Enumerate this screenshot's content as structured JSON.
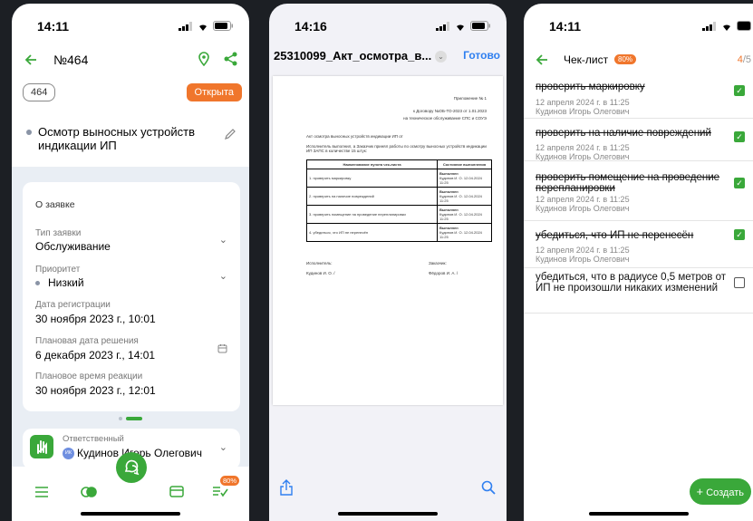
{
  "phone1": {
    "time": "14:11",
    "title": "№464",
    "number_badge": "464",
    "status_badge": "Открыта",
    "subject": "Осмотр выносных устройств индикации ИП",
    "card_title": "О заявке",
    "fields": [
      {
        "label": "Тип заявки",
        "value": "Обслуживание"
      },
      {
        "label": "Приоритет",
        "value": "Низкий"
      },
      {
        "label": "Дата регистрации",
        "value": "30 ноября 2023 г., 10:01"
      },
      {
        "label": "Плановая дата решения",
        "value": "6 декабря 2023 г., 14:01"
      },
      {
        "label": "Плановое время реакции",
        "value": "30 ноября 2023 г., 12:01"
      }
    ],
    "responsible_label": "Ответственный",
    "responsible_initials": "ИК",
    "responsible_name": "Кудинов Игорь Олегович",
    "tab_badge": "80%",
    "colors": {
      "accent": "#3aa83a",
      "orange": "#f0762c"
    }
  },
  "phone2": {
    "time": "14:16",
    "file_title": "25310099_Акт_осмотра_в...",
    "done_label": "Готово",
    "doc": {
      "appendix": "Приложение № 1",
      "contract_line1": "к Договору №ОБ-ТО-2023 от 1.01.2023",
      "contract_line2": "на техническое обслуживание СПС и СОУЭ",
      "act_title": "Акт осмотра выносных устройств индикации ИП от",
      "intro": "Исполнитель выполнил, а Заказчик принял работы по осмотру выносных устройств индикации ИП ЗАПС в количестве 15 штук:",
      "col1": "Наименование пункта чек-листа",
      "col2": "Состояние выполнения",
      "rows": [
        {
          "name": "1. проверить маркировку",
          "status": "Выполнен",
          "who": "Кудинов И. О. 12.04.2024 11:25"
        },
        {
          "name": "2. проверить на наличие повреждений",
          "status": "Выполнен",
          "who": "Кудинов И. О. 12.04.2024 11:25"
        },
        {
          "name": "3. проверить помещение на проведение перепланировки",
          "status": "Выполнен",
          "who": "Кудинов И. О. 12.04.2024 11:25"
        },
        {
          "name": "4. убедиться, что ИП не перенесён",
          "status": "Выполнен",
          "who": "Кудинов И. О. 12.04.2024 11:25"
        }
      ],
      "executor_label": "Исполнитель:",
      "customer_label": "Заказчик:",
      "executor_name": "Кудинов И. О. /",
      "customer_name": "Фёдоров И. А. /"
    }
  },
  "phone3": {
    "time": "14:11",
    "title": "Чек-лист",
    "progress_badge": "80%",
    "counter_done": "4",
    "counter_total": "/5",
    "items": [
      {
        "title": "проверить маркировку",
        "date": "12 апреля 2024 г. в 11:25",
        "user": "Кудинов Игорь Олегович",
        "checked": true
      },
      {
        "title": "проверить на наличие повреждений",
        "date": "12 апреля 2024 г. в 11:25",
        "user": "Кудинов Игорь Олегович",
        "checked": true
      },
      {
        "title": "проверить помещение на проведение перепланировки",
        "date": "12 апреля 2024 г. в 11:25",
        "user": "Кудинов Игорь Олегович",
        "checked": true
      },
      {
        "title": "убедиться, что ИП не перенесён",
        "date": "12 апреля 2024 г. в 11:25",
        "user": "Кудинов Игорь Олегович",
        "checked": true
      },
      {
        "title": "убедиться, что в радиусе 0,5 метров от ИП не произошли никаких изменений",
        "date": "",
        "user": "",
        "checked": false
      }
    ],
    "create_label": "Создать"
  }
}
